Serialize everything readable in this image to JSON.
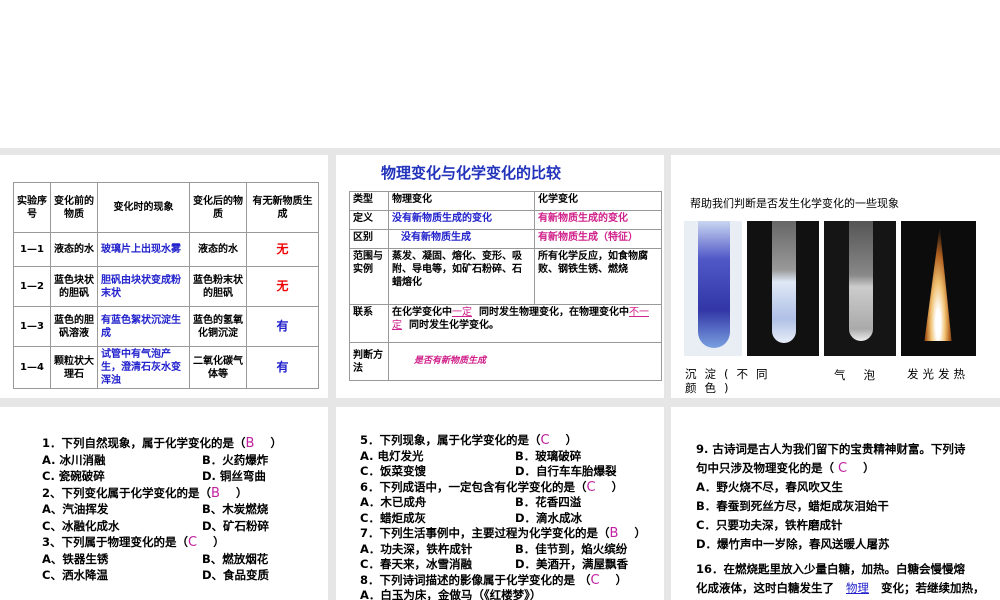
{
  "slide1": {
    "headers": [
      "实验序号",
      "变化前的物质",
      "变化时的现象",
      "变化后的物质",
      "有无新物质生成"
    ],
    "rows": [
      [
        "1—1",
        "液态的水",
        "玻璃片上出现水雾",
        "液态的水",
        "无"
      ],
      [
        "1—2",
        "蓝色块状的胆矾",
        "胆矾由块状变成粉末状",
        "蓝色粉末状的胆矾",
        "无"
      ],
      [
        "1—3",
        "蓝色的胆矾溶液",
        "有蓝色絮状沉淀生成",
        "蓝色的氢氧化铜沉淀",
        "有"
      ],
      [
        "1—4",
        "颗粒状大理石",
        "试管中有气泡产生，澄清石灰水变浑浊",
        "二氧化碳气体等",
        "有"
      ]
    ]
  },
  "slide2": {
    "title": "物理变化与化学变化的比较",
    "rows": [
      [
        "类型",
        "物理变化",
        "化学变化"
      ],
      [
        "定义",
        "没有新物质生成的变化",
        "有新物质生成的变化"
      ],
      [
        "区别",
        "没有新物质生成",
        "有新物质生成（特征）"
      ],
      [
        "范围与实例",
        "蒸发、凝固、熔化、变形、吸附、导电等，如矿石粉碎、石蜡熔化",
        "所有化学反应，如食物腐败、钢铁生锈、燃烧"
      ]
    ],
    "link_label": "联系",
    "link_a": "在化学变化中",
    "link_fill1": "一定",
    "link_b": "同时发生物理变化，在物理变化中",
    "link_fill2": "不一定",
    "link_c": "同时发生化学变化。",
    "judge_label": "判断方法",
    "judge_text": "是否有新物质生成"
  },
  "slide3": {
    "title": "帮助我们判断是否发生化学变化的一些现象",
    "captions": [
      "沉淀(不同颜色)",
      "",
      "气泡",
      "发光发热"
    ]
  },
  "slide4": {
    "lines": [
      [
        "1．下列自然现象，属于化学变化的是（",
        "B",
        "）"
      ],
      [
        "A. 冰川消融",
        "B．火药爆炸"
      ],
      [
        "C. 瓷碗破碎",
        "D. 铜丝弯曲"
      ],
      [
        "2、下列变化属于化学变化的是（",
        "B",
        "）"
      ],
      [
        "A、汽油挥发",
        "B、木炭燃烧"
      ],
      [
        "C、冰融化成水",
        "D、矿石粉碎"
      ],
      [
        "3、下列属于物理变化的是（",
        "C",
        "）"
      ],
      [
        "A、铁器生锈",
        "B、燃放烟花"
      ],
      [
        "C、洒水降温",
        "D、食品变质"
      ]
    ]
  },
  "slide5": {
    "lines": [
      [
        "5．下列现象，属于化学变化的是（",
        "C",
        "）"
      ],
      [
        "A. 电灯发光",
        "B．玻璃破碎"
      ],
      [
        "C．饭菜变馊",
        "D．自行车车胎爆裂"
      ],
      [
        "6．下列成语中，一定包含有化学变化的是（",
        "C",
        "）"
      ],
      [
        "A．木已成舟",
        "B．花香四溢"
      ],
      [
        "C．蜡炬成灰",
        "D．滴水成冰"
      ],
      [
        "7．下列生活事例中，主要过程为化学变化的是（",
        "B",
        "）"
      ],
      [
        "A．功夫深，铁杵成针",
        "B．佳节到，焰火缤纷"
      ],
      [
        "C．春天来，冰雪消融",
        "D．美酒开，满屋飘香"
      ],
      [
        "8．下列诗词描述的影像属于化学变化的是 （",
        "C",
        "）"
      ],
      [
        "A．白玉为床，金做马（《红楼梦》）"
      ]
    ]
  },
  "slide6": {
    "q9a": "9. 古诗词是古人为我们留下的宝贵精神财富。下列诗",
    "q9b": "句中只涉及物理变化的是（",
    "q9ans": "C",
    "q9c": "）",
    "opts": [
      "A．野火烧不尽，春风吹又生",
      "B．春蚕到死丝方尽，蜡炬成灰泪始干",
      "C．只要功夫深，铁杵磨成针",
      "D．爆竹声中一岁除，春风送暖人屠苏"
    ],
    "q16a": "16．在燃烧匙里放入少量白糖，加热。白糖会慢慢熔",
    "q16b": "化成液体，这时白糖发生了",
    "q16ans": "物理",
    "q16c": "变化；若继续加热，"
  }
}
